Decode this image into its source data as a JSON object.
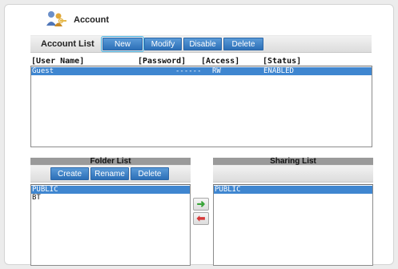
{
  "header": {
    "title": "Account",
    "icon": "users-key-icon"
  },
  "account_list": {
    "label": "Account List",
    "buttons": {
      "new": "New",
      "modify": "Modify",
      "disable": "Disable",
      "delete": "Delete"
    },
    "columns": {
      "user": "[User Name]",
      "password": "[Password]",
      "access": "[Access]",
      "status": "[Status]"
    },
    "rows": [
      {
        "user": "Guest",
        "password": "------",
        "access": "RW",
        "status": "ENABLED"
      }
    ]
  },
  "folder_list": {
    "label": "Folder List",
    "buttons": {
      "create": "Create",
      "rename": "Rename",
      "delete": "Delete"
    },
    "items": [
      "PUBLIC",
      "BT"
    ]
  },
  "sharing_list": {
    "label": "Sharing List",
    "items": [
      "PUBLIC"
    ]
  },
  "transfer": {
    "add_icon": "arrow-right-icon",
    "remove_icon": "arrow-left-icon"
  },
  "colors": {
    "button_blue": "#2c6fb7",
    "selection_blue": "#3f86d0",
    "focus_outline": "#4ab6e6"
  }
}
